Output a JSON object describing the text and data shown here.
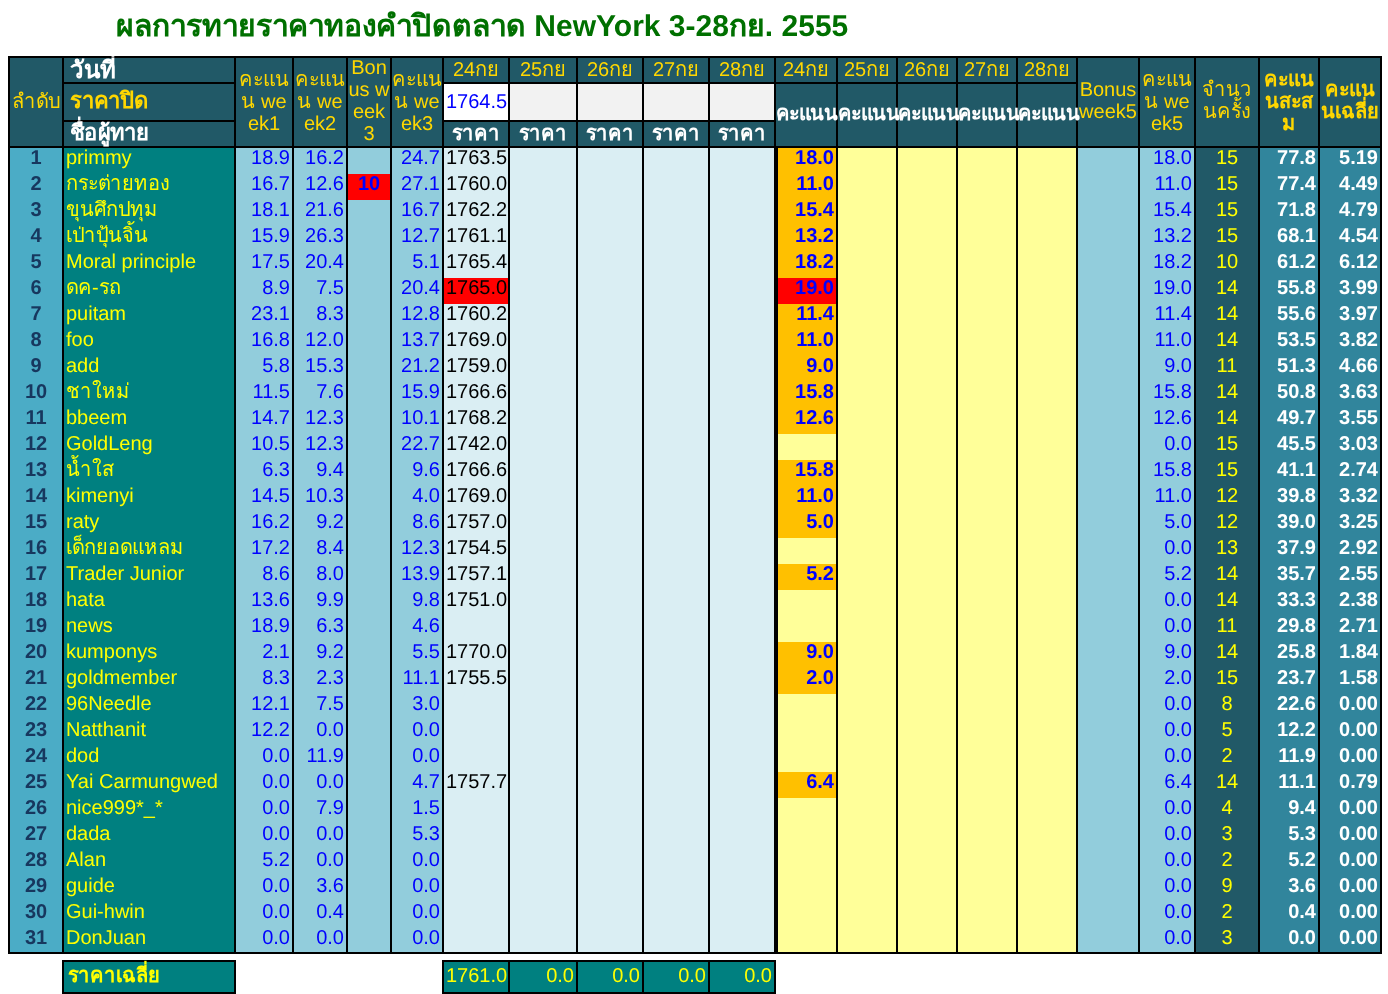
{
  "title": "ผลการทายราคาทองคำปิดตลาด NewYork 3-28กย. 2555",
  "header": {
    "rank": "ลำดับ",
    "date_label": "วันที่",
    "closing_label": "ราคาปิด",
    "name_label": "ชื่อผู้ทาย",
    "week1": "คะแนน week1",
    "week2": "คะแนน week2",
    "bonus3": "Bonus week 3",
    "week3": "คะแนน week3",
    "price_days": [
      {
        "date": "24กย",
        "closing": "1764.5",
        "sub": "ราคา"
      },
      {
        "date": "25กย",
        "sub": "ราคา"
      },
      {
        "date": "26กย",
        "sub": "ราคา"
      },
      {
        "date": "27กย",
        "sub": "ราคา"
      },
      {
        "date": "28กย",
        "sub": "ราคา"
      }
    ],
    "score_days": [
      {
        "date": "24กย",
        "sub": "คะแนน"
      },
      {
        "date": "25กย",
        "sub": "คะแนน"
      },
      {
        "date": "26กย",
        "sub": "คะแนน"
      },
      {
        "date": "27กย",
        "sub": "คะแนน"
      },
      {
        "date": "28กย",
        "sub": "คะแนน"
      }
    ],
    "bonus5": "Bonus week5",
    "week5": "คะแนน week5",
    "count": "จำนวนครั้ง",
    "total": "คะแนนสะสม",
    "average": "คะแนนเฉลี่ย"
  },
  "rows": [
    {
      "rank": "1",
      "name": "primmy",
      "week1": "18.9",
      "week2": "16.2",
      "week3": "24.7",
      "guess": "1763.5",
      "score": "18.0",
      "week5": "18.0",
      "count": "15",
      "total": "77.8",
      "average": "5.19",
      "highlight": false
    },
    {
      "rank": "2",
      "name": "กระต่ายทอง",
      "week1": "16.7",
      "week2": "12.6",
      "bonus3": "10",
      "week3": "27.1",
      "guess": "1760.0",
      "score": "11.0",
      "week5": "11.0",
      "count": "15",
      "total": "77.4",
      "average": "4.49",
      "highlight": false
    },
    {
      "rank": "3",
      "name": "ขุนศึกปทุม",
      "week1": "18.1",
      "week2": "21.6",
      "week3": "16.7",
      "guess": "1762.2",
      "score": "15.4",
      "week5": "15.4",
      "count": "15",
      "total": "71.8",
      "average": "4.79",
      "highlight": false
    },
    {
      "rank": "4",
      "name": "เป่าปุ้นจิ้น",
      "week1": "15.9",
      "week2": "26.3",
      "week3": "12.7",
      "guess": "1761.1",
      "score": "13.2",
      "week5": "13.2",
      "count": "15",
      "total": "68.1",
      "average": "4.54",
      "highlight": false
    },
    {
      "rank": "5",
      "name": "Moral principle",
      "week1": "17.5",
      "week2": "20.4",
      "week3": "5.1",
      "guess": "1765.4",
      "score": "18.2",
      "week5": "18.2",
      "count": "10",
      "total": "61.2",
      "average": "6.12",
      "highlight": false
    },
    {
      "rank": "6",
      "name": "ดค-รถ",
      "week1": "8.9",
      "week2": "7.5",
      "week3": "20.4",
      "guess": "1765.0",
      "score": "19.0",
      "week5": "19.0",
      "count": "14",
      "total": "55.8",
      "average": "3.99",
      "highlight": true
    },
    {
      "rank": "7",
      "name": "puitam",
      "week1": "23.1",
      "week2": "8.3",
      "week3": "12.8",
      "guess": "1760.2",
      "score": "11.4",
      "week5": "11.4",
      "count": "14",
      "total": "55.6",
      "average": "3.97",
      "highlight": false
    },
    {
      "rank": "8",
      "name": "foo",
      "week1": "16.8",
      "week2": "12.0",
      "week3": "13.7",
      "guess": "1769.0",
      "score": "11.0",
      "week5": "11.0",
      "count": "14",
      "total": "53.5",
      "average": "3.82",
      "highlight": false
    },
    {
      "rank": "9",
      "name": "add",
      "week1": "5.8",
      "week2": "15.3",
      "week3": "21.2",
      "guess": "1759.0",
      "score": "9.0",
      "week5": "9.0",
      "count": "11",
      "total": "51.3",
      "average": "4.66",
      "highlight": false
    },
    {
      "rank": "10",
      "name": "ชาใหม่",
      "week1": "11.5",
      "week2": "7.6",
      "week3": "15.9",
      "guess": "1766.6",
      "score": "15.8",
      "week5": "15.8",
      "count": "14",
      "total": "50.8",
      "average": "3.63",
      "highlight": false
    },
    {
      "rank": "11",
      "name": "bbeem",
      "week1": "14.7",
      "week2": "12.3",
      "week3": "10.1",
      "guess": "1768.2",
      "score": "12.6",
      "week5": "12.6",
      "count": "14",
      "total": "49.7",
      "average": "3.55",
      "highlight": false
    },
    {
      "rank": "12",
      "name": "GoldLeng",
      "week1": "10.5",
      "week2": "12.3",
      "week3": "22.7",
      "guess": "1742.0",
      "week5": "0.0",
      "count": "15",
      "total": "45.5",
      "average": "3.03",
      "highlight": false
    },
    {
      "rank": "13",
      "name": "น้ำใส",
      "week1": "6.3",
      "week2": "9.4",
      "week3": "9.6",
      "guess": "1766.6",
      "score": "15.8",
      "week5": "15.8",
      "count": "15",
      "total": "41.1",
      "average": "2.74",
      "highlight": false
    },
    {
      "rank": "14",
      "name": "kimenyi",
      "week1": "14.5",
      "week2": "10.3",
      "week3": "4.0",
      "guess": "1769.0",
      "score": "11.0",
      "week5": "11.0",
      "count": "12",
      "total": "39.8",
      "average": "3.32",
      "highlight": false
    },
    {
      "rank": "15",
      "name": "raty",
      "week1": "16.2",
      "week2": "9.2",
      "week3": "8.6",
      "guess": "1757.0",
      "score": "5.0",
      "week5": "5.0",
      "count": "12",
      "total": "39.0",
      "average": "3.25",
      "highlight": false
    },
    {
      "rank": "16",
      "name": "เด็กยอดแหลม",
      "week1": "17.2",
      "week2": "8.4",
      "week3": "12.3",
      "guess": "1754.5",
      "week5": "0.0",
      "count": "13",
      "total": "37.9",
      "average": "2.92",
      "highlight": false
    },
    {
      "rank": "17",
      "name": "Trader Junior",
      "week1": "8.6",
      "week2": "8.0",
      "week3": "13.9",
      "guess": "1757.1",
      "score": "5.2",
      "week5": "5.2",
      "count": "14",
      "total": "35.7",
      "average": "2.55",
      "highlight": false
    },
    {
      "rank": "18",
      "name": "hata",
      "week1": "13.6",
      "week2": "9.9",
      "week3": "9.8",
      "guess": "1751.0",
      "week5": "0.0",
      "count": "14",
      "total": "33.3",
      "average": "2.38",
      "highlight": false
    },
    {
      "rank": "19",
      "name": "news",
      "week1": "18.9",
      "week2": "6.3",
      "week3": "4.6",
      "week5": "0.0",
      "count": "11",
      "total": "29.8",
      "average": "2.71",
      "highlight": false
    },
    {
      "rank": "20",
      "name": "kumponys",
      "week1": "2.1",
      "week2": "9.2",
      "week3": "5.5",
      "guess": "1770.0",
      "score": "9.0",
      "week5": "9.0",
      "count": "14",
      "total": "25.8",
      "average": "1.84",
      "highlight": false
    },
    {
      "rank": "21",
      "name": "goldmember",
      "week1": "8.3",
      "week2": "2.3",
      "week3": "11.1",
      "guess": "1755.5",
      "score": "2.0",
      "week5": "2.0",
      "count": "15",
      "total": "23.7",
      "average": "1.58",
      "highlight": false
    },
    {
      "rank": "22",
      "name": "96Needle",
      "week1": "12.1",
      "week2": "7.5",
      "week3": "3.0",
      "week5": "0.0",
      "count": "8",
      "total": "22.6",
      "average": "0.00",
      "highlight": false
    },
    {
      "rank": "23",
      "name": "Natthanit",
      "week1": "12.2",
      "week2": "0.0",
      "week3": "0.0",
      "week5": "0.0",
      "count": "5",
      "total": "12.2",
      "average": "0.00",
      "highlight": false
    },
    {
      "rank": "24",
      "name": "dod",
      "week1": "0.0",
      "week2": "11.9",
      "week3": "0.0",
      "week5": "0.0",
      "count": "2",
      "total": "11.9",
      "average": "0.00",
      "highlight": false
    },
    {
      "rank": "25",
      "name": "Yai Carmungwed",
      "week1": "0.0",
      "week2": "0.0",
      "week3": "4.7",
      "guess": "1757.7",
      "score": "6.4",
      "week5": "6.4",
      "count": "14",
      "total": "11.1",
      "average": "0.79",
      "highlight": false
    },
    {
      "rank": "26",
      "name": "nice999*_*",
      "week1": "0.0",
      "week2": "7.9",
      "week3": "1.5",
      "week5": "0.0",
      "count": "4",
      "total": "9.4",
      "average": "0.00",
      "highlight": false
    },
    {
      "rank": "27",
      "name": "dada",
      "week1": "0.0",
      "week2": "0.0",
      "week3": "5.3",
      "week5": "0.0",
      "count": "3",
      "total": "5.3",
      "average": "0.00",
      "highlight": false
    },
    {
      "rank": "28",
      "name": "Alan",
      "week1": "5.2",
      "week2": "0.0",
      "week3": "0.0",
      "week5": "0.0",
      "count": "2",
      "total": "5.2",
      "average": "0.00",
      "highlight": false
    },
    {
      "rank": "29",
      "name": "guide",
      "week1": "0.0",
      "week2": "3.6",
      "week3": "0.0",
      "week5": "0.0",
      "count": "9",
      "total": "3.6",
      "average": "0.00",
      "highlight": false
    },
    {
      "rank": "30",
      "name": "Gui-hwin",
      "week1": "0.0",
      "week2": "0.4",
      "week3": "0.0",
      "week5": "0.0",
      "count": "2",
      "total": "0.4",
      "average": "0.00",
      "highlight": false
    },
    {
      "rank": "31",
      "name": "DonJuan",
      "week1": "0.0",
      "week2": "0.0",
      "week3": "0.0",
      "week5": "0.0",
      "count": "3",
      "total": "0.0",
      "average": "0.00",
      "highlight": false
    }
  ],
  "footer": {
    "label": "ราคาเฉลี่ย",
    "values": [
      "1761.0",
      "0.0",
      "0.0",
      "0.0",
      "0.0"
    ]
  }
}
